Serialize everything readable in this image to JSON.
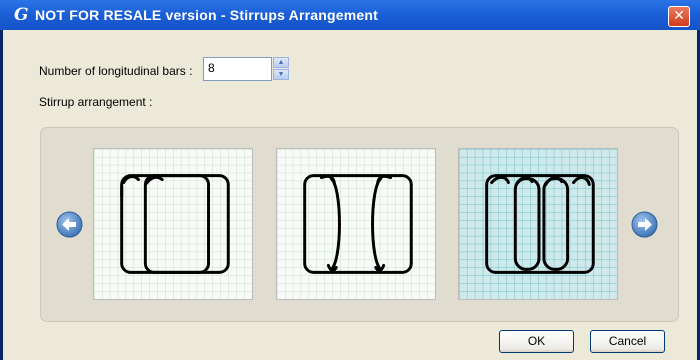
{
  "window": {
    "app_icon": "G",
    "title": "NOT FOR RESALE version - Stirrups Arrangement",
    "close_glyph": "✕"
  },
  "form": {
    "bars_label": "Number of longitudinal bars :",
    "bars_value": "8",
    "arrangement_label": "Stirrup arrangement :"
  },
  "gallery": {
    "selected_index": 2,
    "thumbnails": [
      {
        "name": "arrangement-1",
        "selected": false
      },
      {
        "name": "arrangement-2",
        "selected": false
      },
      {
        "name": "arrangement-3",
        "selected": true
      }
    ]
  },
  "buttons": {
    "ok": "OK",
    "cancel": "Cancel"
  },
  "icons": {
    "prev": "left-arrow-icon",
    "next": "right-arrow-icon",
    "spin_up": "spin-up-icon",
    "spin_down": "spin-down-icon"
  },
  "colors": {
    "titlebar": "#1a5ed6",
    "dialog_bg": "#ece9d8",
    "grid_normal": "#c8e0c8",
    "grid_selected": "#6cc4cc",
    "thumb_selected_bg": "#cfe9ea",
    "nav_arrow": "#4f88c6"
  }
}
